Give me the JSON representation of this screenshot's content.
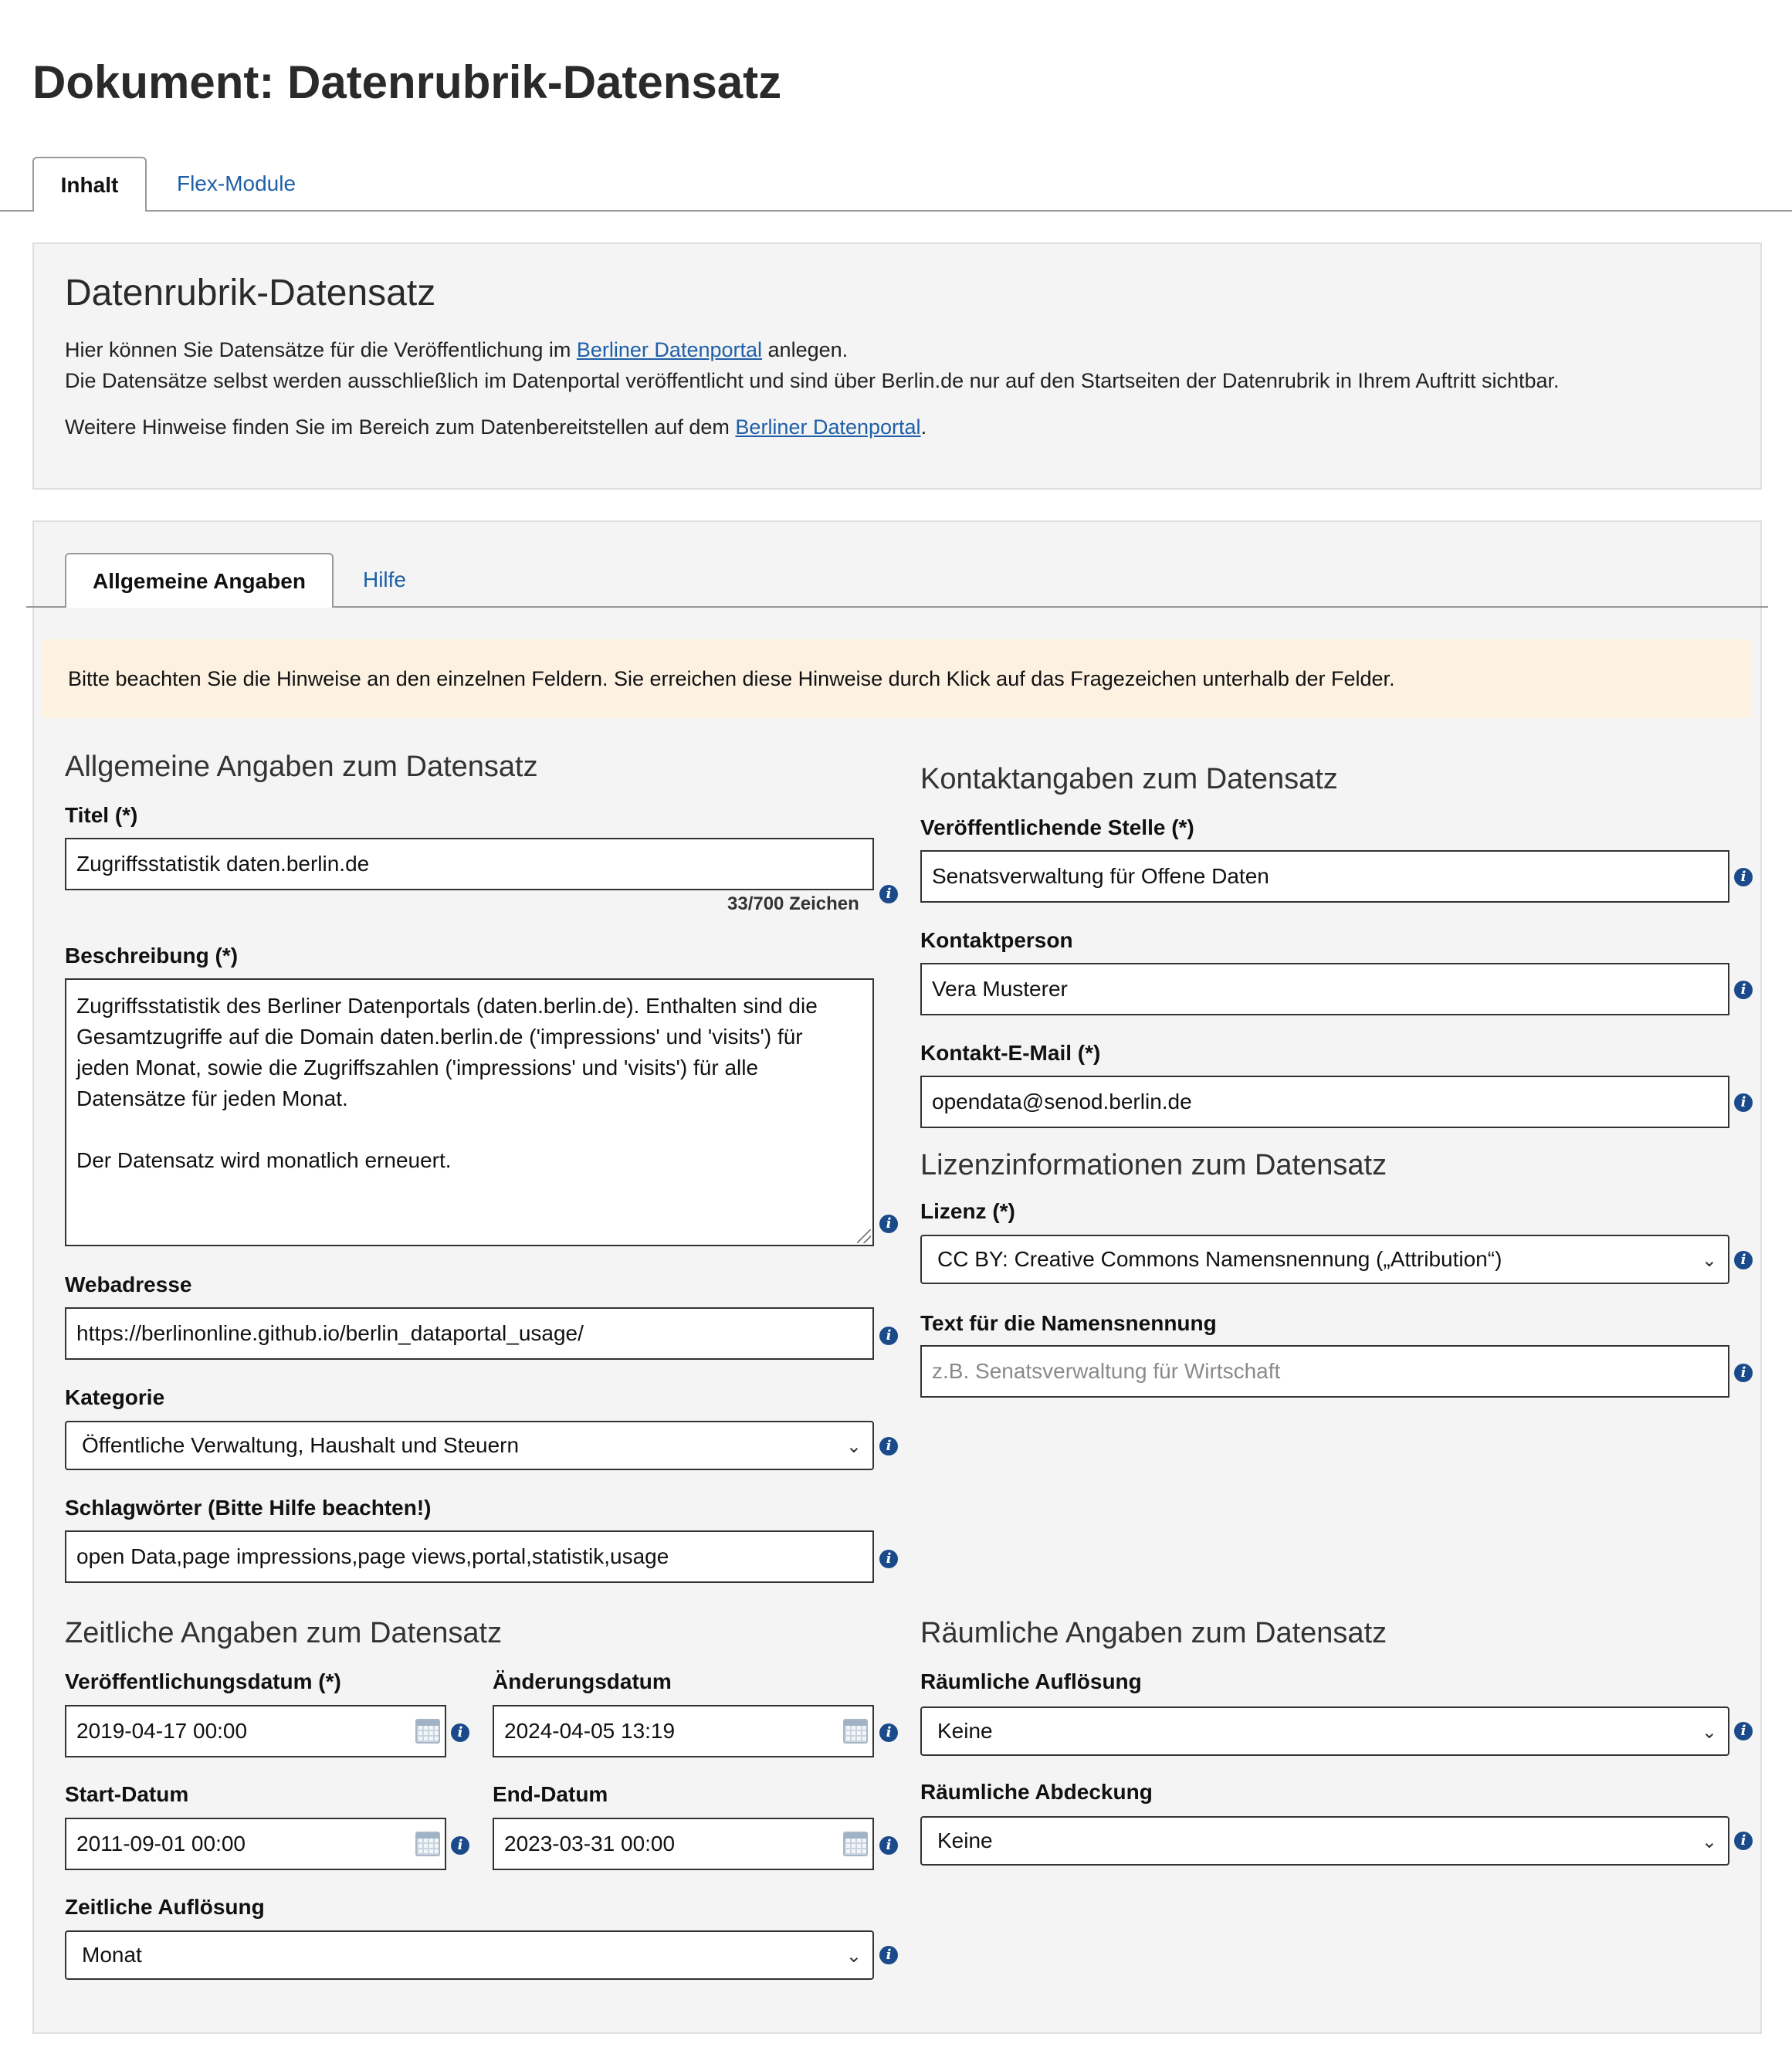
{
  "page_title": "Dokument: Datenrubrik-Datensatz",
  "top_tabs": [
    {
      "label": "Inhalt",
      "active": true
    },
    {
      "label": "Flex-Module",
      "active": false
    }
  ],
  "intro": {
    "title": "Datenrubrik-Datensatz",
    "line1_before": "Hier können Sie Datensätze für die Veröffentlichung im ",
    "line1_link": "Berliner Datenportal",
    "line1_after": " anlegen.",
    "line2": "Die Datensätze selbst werden ausschließlich im Datenportal veröffentlicht und sind über Berlin.de nur auf den Startseiten der Datenrubrik in Ihrem Auftritt sichtbar.",
    "line3_before": "Weitere Hinweise finden Sie im Bereich zum Datenbereitstellen auf dem ",
    "line3_link": "Berliner Datenportal",
    "line3_after": "."
  },
  "form_tabs": [
    {
      "label": "Allgemeine Angaben",
      "active": true
    },
    {
      "label": "Hilfe",
      "active": false
    }
  ],
  "notice": "Bitte beachten Sie die Hinweise an den einzelnen Feldern. Sie erreichen diese Hinweise durch Klick auf das Fragezeichen unterhalb der Felder.",
  "general": {
    "title": "Allgemeine Angaben zum Datensatz",
    "titel_label": "Titel (*)",
    "titel_value": "Zugriffsstatistik daten.berlin.de",
    "titel_counter": "33/700 Zeichen",
    "beschreibung_label": "Beschreibung (*)",
    "beschreibung_lines": [
      "Zugriffsstatistik des Berliner Datenportals (daten.berlin.de). Enthalten sind die",
      "Gesamtzugriffe auf die Domain daten.berlin.de ('impressions' und 'visits') für",
      "jeden Monat, sowie die Zugriffszahlen ('impressions' und 'visits') für alle",
      "Datensätze für jeden Monat.",
      "",
      "Der Datensatz wird monatlich erneuert."
    ],
    "webadresse_label": "Webadresse",
    "webadresse_value": "https://berlinonline.github.io/berlin_dataportal_usage/",
    "kategorie_label": "Kategorie",
    "kategorie_value": "Öffentliche Verwaltung, Haushalt und Steuern",
    "schlagwoerter_label": "Schlagwörter (Bitte Hilfe beachten!)",
    "schlagwoerter_value": "open Data,page impressions,page views,portal,statistik,usage"
  },
  "contact": {
    "title": "Kontaktangaben zum Datensatz",
    "stelle_label": "Veröffentlichende Stelle (*)",
    "stelle_value": "Senatsverwaltung für Offene Daten",
    "person_label": "Kontaktperson",
    "person_value": "Vera Musterer",
    "email_label": "Kontakt-E-Mail (*)",
    "email_value": "opendata@senod.berlin.de"
  },
  "license": {
    "title": "Lizenzinformationen zum Datensatz",
    "lizenz_label": "Lizenz (*)",
    "lizenz_value": "CC BY: Creative Commons Namensnennung („Attribution“)",
    "namensnennung_label": "Text für die Namensnennung",
    "namensnennung_placeholder": "z.B. Senatsverwaltung für Wirtschaft"
  },
  "temporal": {
    "title": "Zeitliche Angaben zum Datensatz",
    "veroeff_label": "Veröffentlichungsdatum (*)",
    "veroeff_value": "2019-04-17 00:00",
    "aenderung_label": "Änderungsdatum",
    "aenderung_value": "2024-04-05 13:19",
    "start_label": "Start-Datum",
    "start_value": "2011-09-01 00:00",
    "end_label": "End-Datum",
    "end_value": "2023-03-31 00:00",
    "aufloesung_label": "Zeitliche Auflösung",
    "aufloesung_value": "Monat"
  },
  "spatial": {
    "title": "Räumliche Angaben zum Datensatz",
    "aufloesung_label": "Räumliche Auflösung",
    "aufloesung_value": "Keine",
    "abdeckung_label": "Räumliche Abdeckung",
    "abdeckung_value": "Keine"
  },
  "icons": {
    "info": "info-icon",
    "calendar": "calendar-icon",
    "select_chevron": "chevron-down-icon"
  },
  "colors": {
    "link": "#1f5fa8",
    "notice_bg": "#fdf2e2",
    "panel_bg": "#f4f4f4",
    "info_icon": "#1b4a8a"
  }
}
